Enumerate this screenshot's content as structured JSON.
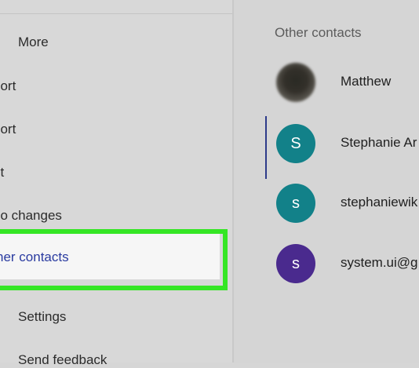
{
  "left_menu": {
    "more_label": "More",
    "item_export": "port",
    "item_import": "port",
    "item_print": "nt",
    "item_undo": "do changes",
    "item_other_contacts": "her contacts",
    "settings_label": "Settings",
    "feedback_label": "Send feedback"
  },
  "right_panel": {
    "section_title": "Other contacts",
    "contacts": [
      {
        "name": "Matthew",
        "initial": "",
        "color": "#3b3a34"
      },
      {
        "name": "Stephanie Ar",
        "initial": "S",
        "color": "#128189"
      },
      {
        "name": "stephaniewik",
        "initial": "s",
        "color": "#128189"
      },
      {
        "name": "system.ui@g",
        "initial": "s",
        "color": "#4a2a8e"
      }
    ]
  },
  "colors": {
    "highlight_border": "#35e625",
    "selected_text": "#2a3ba0"
  }
}
